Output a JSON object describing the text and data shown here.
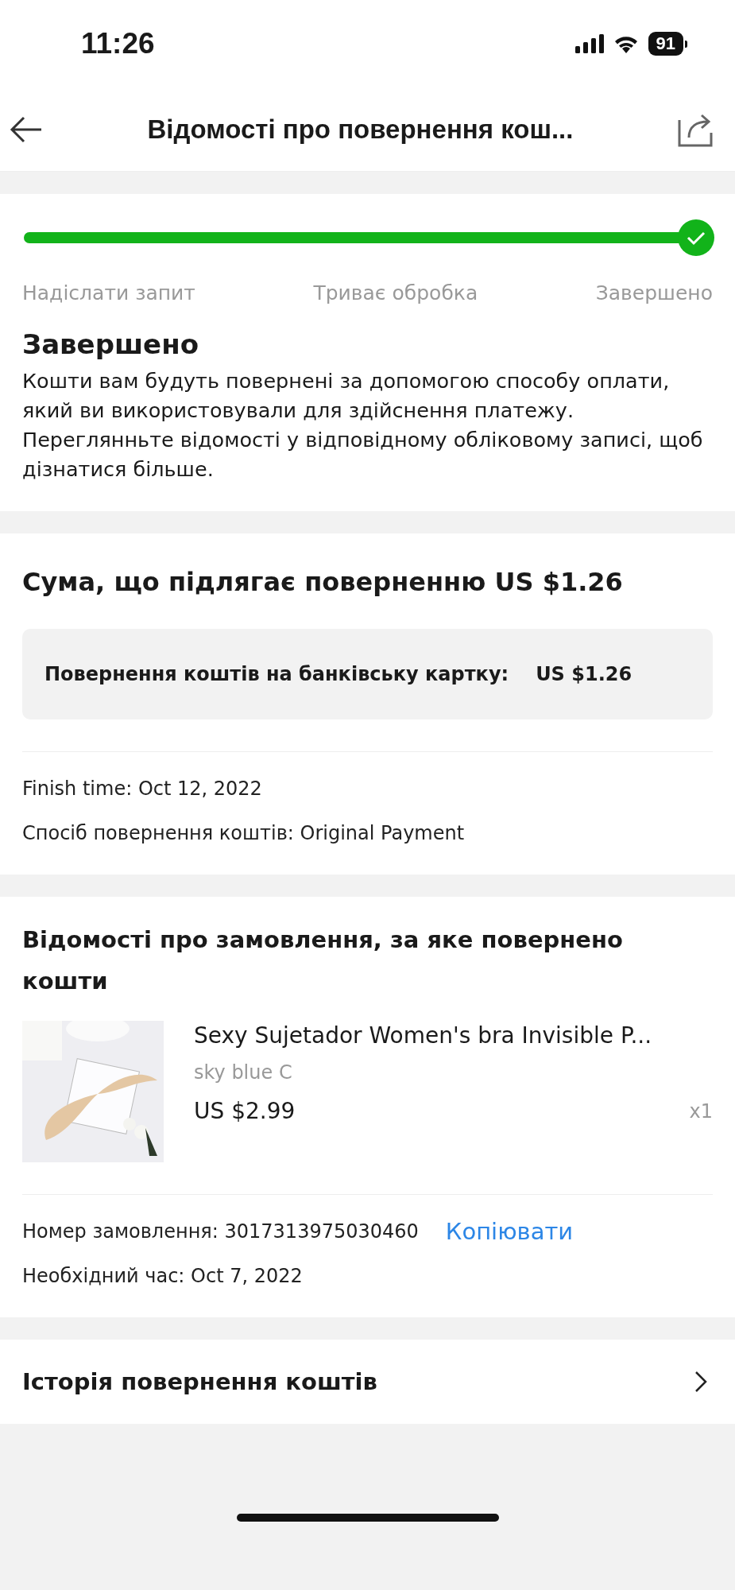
{
  "status_bar": {
    "time": "11:26",
    "battery": "91"
  },
  "nav": {
    "title": "Відомості про повернення кош..."
  },
  "progress": {
    "level": 1,
    "steps": [
      "Надіслати запит",
      "Триває обробка",
      "Завершено"
    ],
    "status_title": "Завершено",
    "status_text": "Кошти вам будуть повернені за допомогою способу оплати, який ви використовували для здійснення платежу. Переглянньте відомості у відповідному обліковому записі, щоб дізнатися більше."
  },
  "refund": {
    "heading": "Сума, що підлягає поверненню US $1.26",
    "breakdown": [
      {
        "label": "Повернення коштів на банківську картку:",
        "amount": "US $1.26"
      }
    ],
    "details": [
      "Finish time: Oct 12, 2022",
      "Спосіб повернення коштів: Original Payment"
    ]
  },
  "order": {
    "heading": "Відомості про замовлення, за яке повернено кошти",
    "product": {
      "kind": "picture",
      "title": "Sexy Sujetador Women's bra Invisible P...",
      "variant": "sky blue C",
      "price": "US $2.99",
      "quantity": "x1"
    },
    "number_label": "Номер замовлення: 3017313975030460",
    "copy": "Копіювати",
    "time": "Необхідний час: Oct 7, 2022"
  },
  "history": {
    "label": "Історія повернення коштів"
  }
}
